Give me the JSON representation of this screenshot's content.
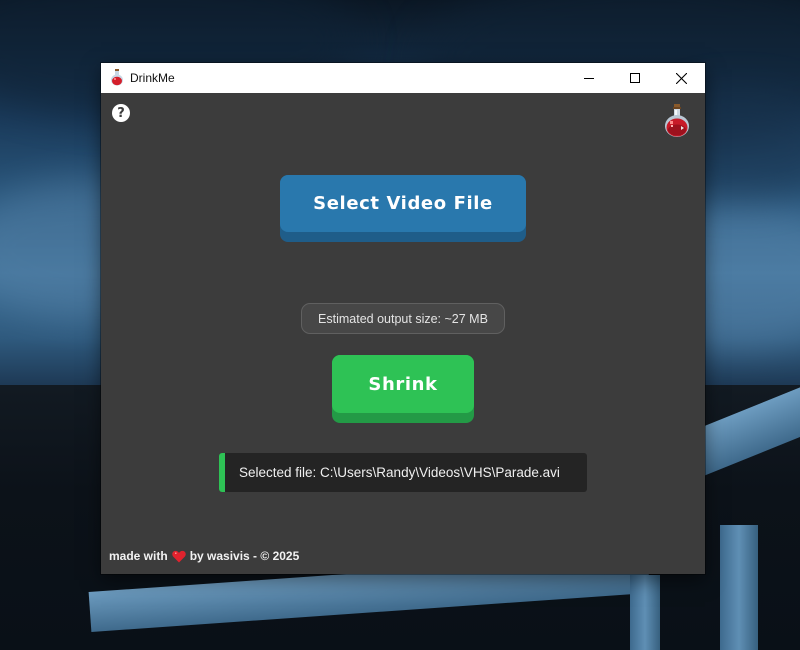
{
  "window": {
    "title": "DrinkMe"
  },
  "controls": {
    "minimize_icon": "minimize-icon",
    "maximize_icon": "maximize-icon",
    "close_icon": "close-icon"
  },
  "toolbar": {
    "help_label": "?",
    "help_icon": "question-circle-icon",
    "logo_icon": "potion-bottle-icon"
  },
  "main": {
    "select_button_label": "Select Video File",
    "estimate_text": "Estimated output size: ~27 MB",
    "shrink_button_label": "Shrink",
    "selected_file_text": "Selected file: C:\\Users\\Randy\\Videos\\VHS\\Parade.avi"
  },
  "footer": {
    "prefix": "made with",
    "heart_icon": "heart-icon",
    "suffix": "by wasivis - © 2025"
  },
  "colors": {
    "background": "#3c3c3c",
    "select_button": "#2978ad",
    "shrink_button": "#2ec255",
    "accent": "#2ec255",
    "heart": "#e0232e"
  }
}
